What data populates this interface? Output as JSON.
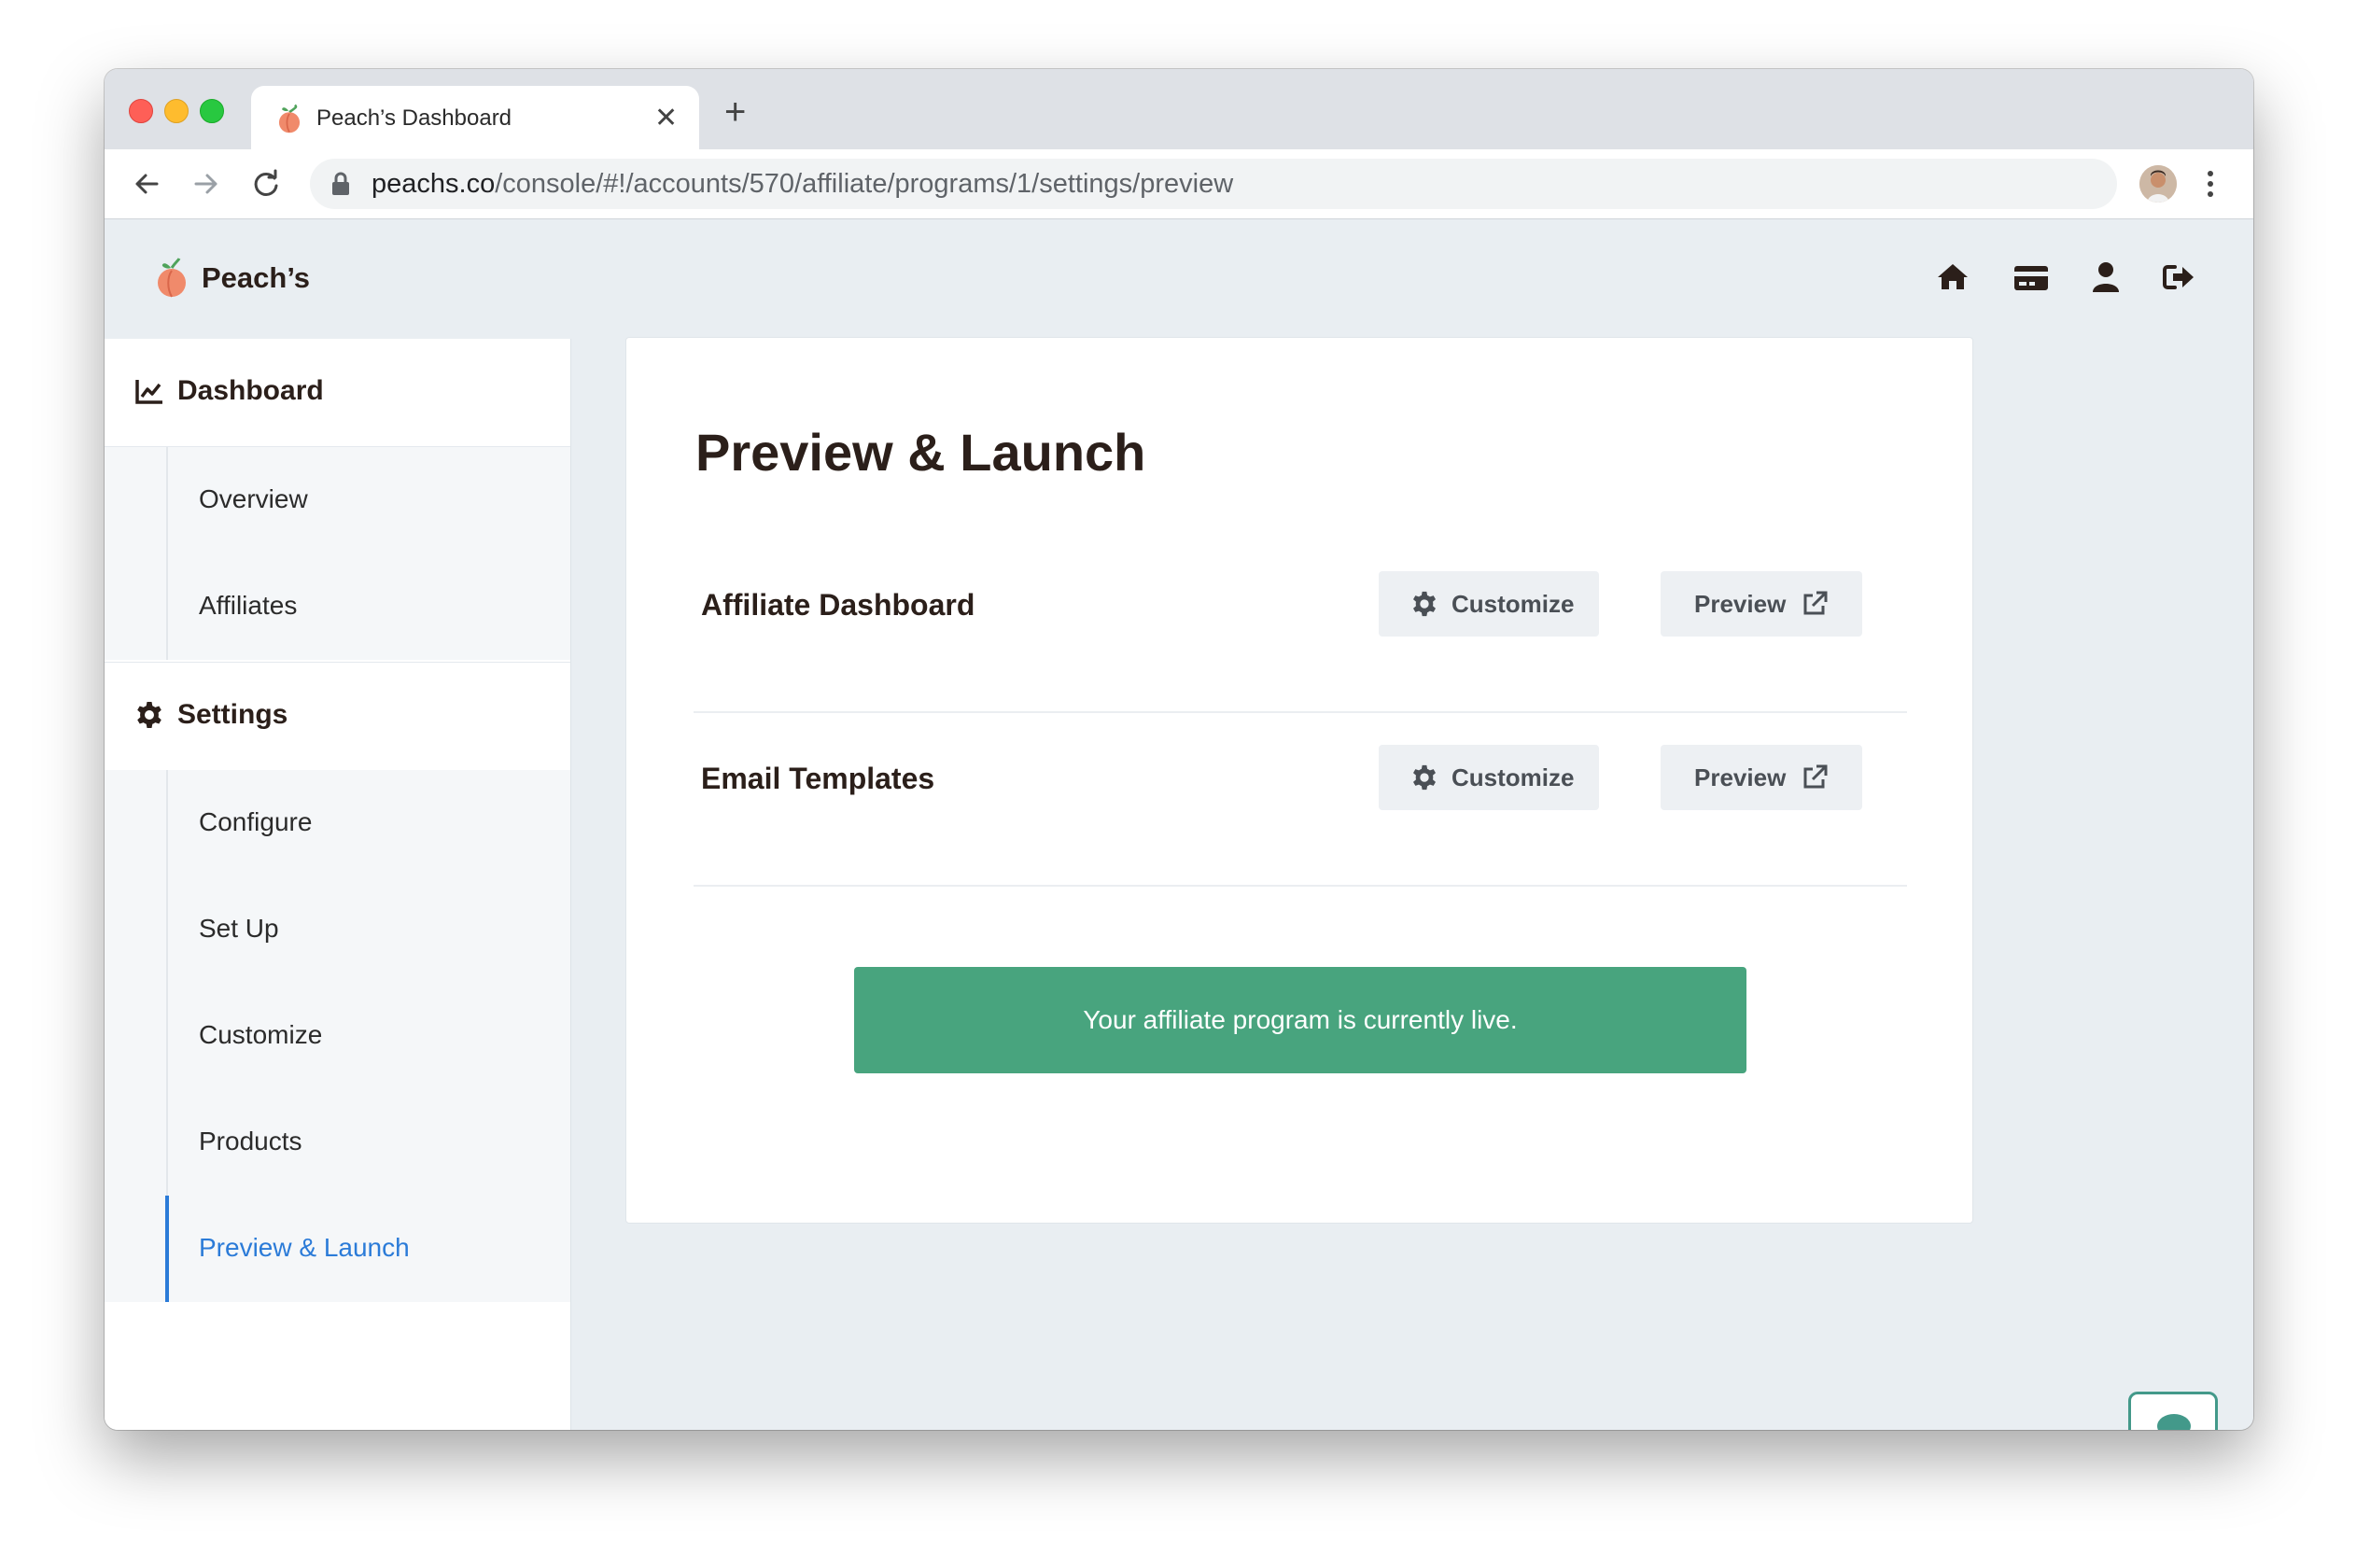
{
  "browser": {
    "tab_title": "Peach’s Dashboard",
    "tab_close": "✕",
    "new_tab": "+",
    "url_host": "peachs.co",
    "url_path": "/console/#!/accounts/570/affiliate/programs/1/settings/preview"
  },
  "header": {
    "brand": "Peach’s",
    "icons": [
      "home-icon",
      "credit-card-icon",
      "user-icon",
      "sign-out-icon"
    ]
  },
  "sidebar": {
    "sections": [
      {
        "label": "Dashboard",
        "icon": "line-chart-icon",
        "items": [
          {
            "label": "Overview",
            "active": false
          },
          {
            "label": "Affiliates",
            "active": false
          }
        ]
      },
      {
        "label": "Settings",
        "icon": "gear-icon",
        "items": [
          {
            "label": "Configure",
            "active": false
          },
          {
            "label": "Set Up",
            "active": false
          },
          {
            "label": "Customize",
            "active": false
          },
          {
            "label": "Products",
            "active": false
          },
          {
            "label": "Preview & Launch",
            "active": true
          }
        ]
      }
    ]
  },
  "main": {
    "title": "Preview & Launch",
    "rows": [
      {
        "label": "Affiliate Dashboard",
        "customize_label": "Customize",
        "preview_label": "Preview"
      },
      {
        "label": "Email Templates",
        "customize_label": "Customize",
        "preview_label": "Preview"
      }
    ],
    "status_message": "Your affiliate program is currently live."
  },
  "colors": {
    "accent": "#2b7bd8",
    "success": "#48a47e",
    "chat_border": "#43998a",
    "text_dark": "#2b1f1a",
    "app_bg": "#e9eef2"
  }
}
